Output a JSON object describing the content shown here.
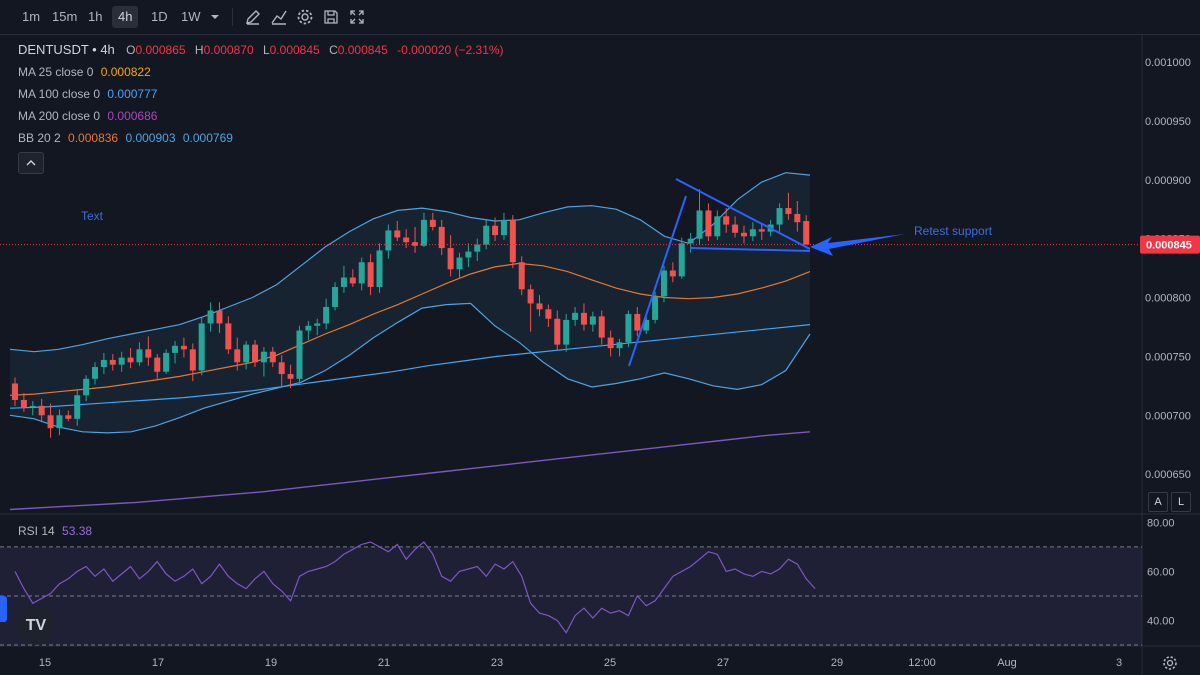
{
  "toolbar": {
    "timeframes": [
      {
        "label": "1m",
        "active": false
      },
      {
        "label": "15m",
        "active": false
      },
      {
        "label": "1h",
        "active": false
      },
      {
        "label": "4h",
        "active": true
      },
      {
        "label": "1D",
        "active": false
      },
      {
        "label": "1W",
        "active": false
      }
    ],
    "tools": [
      "chevron-down-icon",
      "pencil-icon",
      "indicators-icon",
      "gear-icon",
      "save-icon",
      "fullscreen-icon"
    ]
  },
  "legend": {
    "symbol": "DENTUSDT",
    "interval": " • 4h",
    "o_label": "O",
    "o_value": "0.000865",
    "h_label": "H",
    "h_value": "0.000870",
    "l_label": "L",
    "l_value": "0.000845",
    "c_label": "C",
    "c_value": "0.000845",
    "change": "-0.000020 (−2.31%)",
    "ma25_label": "MA 25 close 0",
    "ma25_value": "0.000822",
    "ma100_label": "MA 100 close 0",
    "ma100_value": "0.000777",
    "ma200_label": "MA 200 close 0",
    "ma200_value": "0.000686",
    "bb_label": "BB 20 2",
    "bb_basis": "0.000836",
    "bb_upper": "0.000903",
    "bb_lower": "0.000769",
    "rsi_label": "RSI 14",
    "rsi_value": "53.38"
  },
  "annotations": {
    "text_label": "Text",
    "retest_label": "Retest support"
  },
  "buttons": {
    "auto": "A",
    "log": "L"
  },
  "colors": {
    "up": "#26a69a",
    "down": "#ef5350",
    "ma25": "#f7a600",
    "ma100": "#42a5f5",
    "ma200": "#7e57c2",
    "bb": "#4fa3e0",
    "basis": "#e8772e",
    "rsi": "#7e57c2",
    "drawing": "#2962ff",
    "price_tag": "#f23645"
  },
  "chart_data": [
    {
      "type": "candlestick",
      "title": "DENTUSDT • 4h",
      "y_ticks": [
        "0.001000",
        "0.000950",
        "0.000900",
        "0.000850",
        "0.000800",
        "0.000750",
        "0.000700",
        "0.000650"
      ],
      "x_ticks": [
        "15",
        "17",
        "19",
        "21",
        "23",
        "25",
        "27",
        "29",
        "12:00",
        "Aug",
        "3"
      ],
      "last_price": "0.000845",
      "ylim": [
        0.000617,
        0.001023
      ],
      "candles": [
        {
          "o": 0.000727,
          "h": 0.000732,
          "l": 0.000708,
          "c": 0.000713
        },
        {
          "o": 0.000713,
          "h": 0.000719,
          "l": 0.000703,
          "c": 0.000707
        },
        {
          "o": 0.000707,
          "h": 0.000712,
          "l": 0.0007,
          "c": 0.000708
        },
        {
          "o": 0.000708,
          "h": 0.000714,
          "l": 0.000694,
          "c": 0.0007
        },
        {
          "o": 0.0007,
          "h": 0.00071,
          "l": 0.000681,
          "c": 0.000689
        },
        {
          "o": 0.000689,
          "h": 0.000705,
          "l": 0.000683,
          "c": 0.0007
        },
        {
          "o": 0.0007,
          "h": 0.000704,
          "l": 0.000695,
          "c": 0.000697
        },
        {
          "o": 0.000697,
          "h": 0.000721,
          "l": 0.000691,
          "c": 0.000717
        },
        {
          "o": 0.000717,
          "h": 0.000734,
          "l": 0.000712,
          "c": 0.000731
        },
        {
          "o": 0.000731,
          "h": 0.000745,
          "l": 0.000726,
          "c": 0.000741
        },
        {
          "o": 0.000741,
          "h": 0.000753,
          "l": 0.000735,
          "c": 0.000747
        },
        {
          "o": 0.000747,
          "h": 0.000752,
          "l": 0.000738,
          "c": 0.000743
        },
        {
          "o": 0.000743,
          "h": 0.000754,
          "l": 0.000737,
          "c": 0.000749
        },
        {
          "o": 0.000749,
          "h": 0.000757,
          "l": 0.00074,
          "c": 0.000745
        },
        {
          "o": 0.000745,
          "h": 0.000762,
          "l": 0.000742,
          "c": 0.000756
        },
        {
          "o": 0.000756,
          "h": 0.000767,
          "l": 0.000742,
          "c": 0.000749
        },
        {
          "o": 0.000749,
          "h": 0.000752,
          "l": 0.000731,
          "c": 0.000737
        },
        {
          "o": 0.000737,
          "h": 0.000756,
          "l": 0.000735,
          "c": 0.000753
        },
        {
          "o": 0.000753,
          "h": 0.000763,
          "l": 0.000744,
          "c": 0.000759
        },
        {
          "o": 0.000759,
          "h": 0.000766,
          "l": 0.000749,
          "c": 0.000756
        },
        {
          "o": 0.000756,
          "h": 0.000761,
          "l": 0.000729,
          "c": 0.000738
        },
        {
          "o": 0.000738,
          "h": 0.000783,
          "l": 0.000734,
          "c": 0.000778
        },
        {
          "o": 0.000778,
          "h": 0.000796,
          "l": 0.000771,
          "c": 0.000789
        },
        {
          "o": 0.000789,
          "h": 0.000796,
          "l": 0.00077,
          "c": 0.000778
        },
        {
          "o": 0.000778,
          "h": 0.000784,
          "l": 0.000752,
          "c": 0.000756
        },
        {
          "o": 0.000756,
          "h": 0.000766,
          "l": 0.000738,
          "c": 0.000745
        },
        {
          "o": 0.000745,
          "h": 0.000763,
          "l": 0.000739,
          "c": 0.00076
        },
        {
          "o": 0.00076,
          "h": 0.000764,
          "l": 0.000741,
          "c": 0.000745
        },
        {
          "o": 0.000745,
          "h": 0.000758,
          "l": 0.000733,
          "c": 0.000754
        },
        {
          "o": 0.000754,
          "h": 0.000758,
          "l": 0.000741,
          "c": 0.000745
        },
        {
          "o": 0.000745,
          "h": 0.000751,
          "l": 0.000724,
          "c": 0.000735
        },
        {
          "o": 0.000735,
          "h": 0.000743,
          "l": 0.000723,
          "c": 0.000731
        },
        {
          "o": 0.000731,
          "h": 0.000776,
          "l": 0.000727,
          "c": 0.000772
        },
        {
          "o": 0.000772,
          "h": 0.00078,
          "l": 0.000764,
          "c": 0.000776
        },
        {
          "o": 0.000776,
          "h": 0.000782,
          "l": 0.000768,
          "c": 0.000778
        },
        {
          "o": 0.000778,
          "h": 0.000799,
          "l": 0.000773,
          "c": 0.000792
        },
        {
          "o": 0.000792,
          "h": 0.000813,
          "l": 0.000789,
          "c": 0.000809
        },
        {
          "o": 0.000809,
          "h": 0.000827,
          "l": 0.000804,
          "c": 0.000817
        },
        {
          "o": 0.000817,
          "h": 0.000824,
          "l": 0.000809,
          "c": 0.000812
        },
        {
          "o": 0.000812,
          "h": 0.000834,
          "l": 0.000806,
          "c": 0.00083
        },
        {
          "o": 0.00083,
          "h": 0.000837,
          "l": 0.000802,
          "c": 0.000809
        },
        {
          "o": 0.000809,
          "h": 0.000846,
          "l": 0.000804,
          "c": 0.00084
        },
        {
          "o": 0.00084,
          "h": 0.000862,
          "l": 0.000833,
          "c": 0.000857
        },
        {
          "o": 0.000857,
          "h": 0.000865,
          "l": 0.000848,
          "c": 0.000851
        },
        {
          "o": 0.000851,
          "h": 0.000858,
          "l": 0.000842,
          "c": 0.000847
        },
        {
          "o": 0.000847,
          "h": 0.00086,
          "l": 0.000838,
          "c": 0.000844
        },
        {
          "o": 0.000844,
          "h": 0.000872,
          "l": 0.000843,
          "c": 0.000866
        },
        {
          "o": 0.000866,
          "h": 0.000872,
          "l": 0.000857,
          "c": 0.00086
        },
        {
          "o": 0.00086,
          "h": 0.000866,
          "l": 0.000836,
          "c": 0.000842
        },
        {
          "o": 0.000842,
          "h": 0.000853,
          "l": 0.000818,
          "c": 0.000824
        },
        {
          "o": 0.000824,
          "h": 0.000838,
          "l": 0.000816,
          "c": 0.000834
        },
        {
          "o": 0.000834,
          "h": 0.000846,
          "l": 0.000826,
          "c": 0.000839
        },
        {
          "o": 0.000839,
          "h": 0.00085,
          "l": 0.000831,
          "c": 0.000845
        },
        {
          "o": 0.000845,
          "h": 0.000866,
          "l": 0.000841,
          "c": 0.000861
        },
        {
          "o": 0.000861,
          "h": 0.000868,
          "l": 0.000848,
          "c": 0.000853
        },
        {
          "o": 0.000853,
          "h": 0.000872,
          "l": 0.000849,
          "c": 0.000866
        },
        {
          "o": 0.000866,
          "h": 0.00087,
          "l": 0.000825,
          "c": 0.00083
        },
        {
          "o": 0.00083,
          "h": 0.000835,
          "l": 0.000802,
          "c": 0.000807
        },
        {
          "o": 0.000807,
          "h": 0.000811,
          "l": 0.000771,
          "c": 0.000795
        },
        {
          "o": 0.000795,
          "h": 0.000802,
          "l": 0.000784,
          "c": 0.00079
        },
        {
          "o": 0.00079,
          "h": 0.000794,
          "l": 0.000775,
          "c": 0.000782
        },
        {
          "o": 0.000782,
          "h": 0.000789,
          "l": 0.000755,
          "c": 0.00076
        },
        {
          "o": 0.00076,
          "h": 0.000786,
          "l": 0.000754,
          "c": 0.000781
        },
        {
          "o": 0.000781,
          "h": 0.000792,
          "l": 0.000776,
          "c": 0.000787
        },
        {
          "o": 0.000787,
          "h": 0.000795,
          "l": 0.000772,
          "c": 0.000777
        },
        {
          "o": 0.000777,
          "h": 0.000788,
          "l": 0.000771,
          "c": 0.000784
        },
        {
          "o": 0.000784,
          "h": 0.000789,
          "l": 0.00076,
          "c": 0.000766
        },
        {
          "o": 0.000766,
          "h": 0.000772,
          "l": 0.00075,
          "c": 0.000757
        },
        {
          "o": 0.000757,
          "h": 0.000765,
          "l": 0.00075,
          "c": 0.000762
        },
        {
          "o": 0.000762,
          "h": 0.000789,
          "l": 0.000758,
          "c": 0.000786
        },
        {
          "o": 0.000786,
          "h": 0.000792,
          "l": 0.000767,
          "c": 0.000772
        },
        {
          "o": 0.000772,
          "h": 0.000786,
          "l": 0.000769,
          "c": 0.000781
        },
        {
          "o": 0.000781,
          "h": 0.000805,
          "l": 0.000778,
          "c": 0.000801
        },
        {
          "o": 0.000801,
          "h": 0.000827,
          "l": 0.000796,
          "c": 0.000823
        },
        {
          "o": 0.000823,
          "h": 0.00083,
          "l": 0.000813,
          "c": 0.000818
        },
        {
          "o": 0.000818,
          "h": 0.000851,
          "l": 0.000816,
          "c": 0.000846
        },
        {
          "o": 0.000846,
          "h": 0.000855,
          "l": 0.000838,
          "c": 0.00085
        },
        {
          "o": 0.00085,
          "h": 0.000892,
          "l": 0.000845,
          "c": 0.000874
        },
        {
          "o": 0.000874,
          "h": 0.00088,
          "l": 0.000848,
          "c": 0.000852
        },
        {
          "o": 0.000852,
          "h": 0.000874,
          "l": 0.000849,
          "c": 0.000869
        },
        {
          "o": 0.000869,
          "h": 0.000876,
          "l": 0.000855,
          "c": 0.000862
        },
        {
          "o": 0.000862,
          "h": 0.000869,
          "l": 0.000851,
          "c": 0.000855
        },
        {
          "o": 0.000855,
          "h": 0.000861,
          "l": 0.000846,
          "c": 0.000852
        },
        {
          "o": 0.000852,
          "h": 0.000864,
          "l": 0.000848,
          "c": 0.000858
        },
        {
          "o": 0.000858,
          "h": 0.000863,
          "l": 0.000849,
          "c": 0.000856
        },
        {
          "o": 0.000856,
          "h": 0.000866,
          "l": 0.000852,
          "c": 0.000862
        },
        {
          "o": 0.000862,
          "h": 0.00088,
          "l": 0.000856,
          "c": 0.000876
        },
        {
          "o": 0.000876,
          "h": 0.000889,
          "l": 0.000866,
          "c": 0.000871
        },
        {
          "o": 0.000871,
          "h": 0.000882,
          "l": 0.000856,
          "c": 0.000864
        },
        {
          "o": 0.000865,
          "h": 0.00087,
          "l": 0.000845,
          "c": 0.000845
        }
      ],
      "series": [
        {
          "name": "MA 25 close 0",
          "values": [
            0.000717,
            0.000718,
            0.00072,
            0.000722,
            0.000724,
            0.000727,
            0.00073,
            0.000733,
            0.000737,
            0.000741,
            0.000745,
            0.000751,
            0.00076,
            0.000769,
            0.000777,
            0.000786,
            0.000794,
            0.000803,
            0.000812,
            0.00082,
            0.000826,
            0.000829,
            0.000827,
            0.000822,
            0.000815,
            0.000808,
            0.000803,
            0.0008,
            0.000799,
            0.0008,
            0.000803,
            0.000808,
            0.000814,
            0.000822
          ]
        },
        {
          "name": "MA 100 close 0",
          "values": [
            0.000706,
            0.000707,
            0.000709,
            0.000711,
            0.000713,
            0.000715,
            0.000718,
            0.000721,
            0.000725,
            0.000729,
            0.000733,
            0.000737,
            0.000742,
            0.000746,
            0.00075,
            0.000753,
            0.000756,
            0.000759,
            0.000762,
            0.000765,
            0.000768,
            0.000771,
            0.000774,
            0.000777
          ]
        },
        {
          "name": "MA 200 close 0",
          "values": [
            0.00062,
            0.000622,
            0.000624,
            0.000626,
            0.000629,
            0.000632,
            0.000635,
            0.000639,
            0.000643,
            0.000647,
            0.000651,
            0.000655,
            0.000659,
            0.000663,
            0.000667,
            0.000671,
            0.000675,
            0.000679,
            0.000683,
            0.000686
          ]
        },
        {
          "name": "BB upper",
          "values": [
            0.000756,
            0.000754,
            0.000756,
            0.00076,
            0.000765,
            0.000769,
            0.000773,
            0.000777,
            0.000784,
            0.000792,
            0.0008,
            0.000811,
            0.000827,
            0.000843,
            0.000856,
            0.000867,
            0.000874,
            0.000876,
            0.000873,
            0.000868,
            0.000865,
            0.000866,
            0.000872,
            0.000877,
            0.000878,
            0.000875,
            0.000866,
            0.000852,
            0.000846,
            0.000862,
            0.000883,
            0.000898,
            0.000906,
            0.000904
          ]
        },
        {
          "name": "BB lower",
          "values": [
            0.0007,
            0.000697,
            0.00069,
            0.000686,
            0.000685,
            0.000686,
            0.000691,
            0.000698,
            0.000706,
            0.000712,
            0.000718,
            0.000723,
            0.000728,
            0.000738,
            0.000751,
            0.000766,
            0.000779,
            0.000791,
            0.000794,
            0.000795,
            0.000776,
            0.000762,
            0.000745,
            0.000731,
            0.000724,
            0.000727,
            0.000731,
            0.000736,
            0.000731,
            0.000725,
            0.000722,
            0.000726,
            0.000738,
            0.000769
          ]
        }
      ]
    },
    {
      "type": "line",
      "title": "RSI 14",
      "y_ticks": [
        "80.00",
        "60.00",
        "40.00"
      ],
      "ylim": [
        30,
        83
      ],
      "levels": [
        70,
        50,
        30
      ],
      "series": [
        {
          "name": "RSI 14",
          "values": [
            60,
            53,
            47,
            49,
            51,
            55,
            57,
            60,
            62,
            58,
            61,
            56,
            59,
            62,
            57,
            60,
            64,
            59,
            56,
            58,
            61,
            55,
            58,
            63,
            58,
            55,
            53,
            57,
            60,
            55,
            52,
            48,
            58,
            60,
            61,
            62,
            64,
            67,
            69,
            71,
            72,
            70,
            68,
            71,
            65,
            69,
            72,
            67,
            58,
            56,
            60,
            61,
            62,
            58,
            63,
            61,
            64,
            58,
            47,
            43,
            42,
            40,
            35,
            42,
            45,
            41,
            45,
            43,
            44,
            42,
            50,
            46,
            48,
            53,
            58,
            60,
            62,
            65,
            68,
            67,
            60,
            61,
            59,
            58,
            60,
            59,
            61,
            65,
            63,
            57,
            53
          ]
        }
      ]
    }
  ]
}
